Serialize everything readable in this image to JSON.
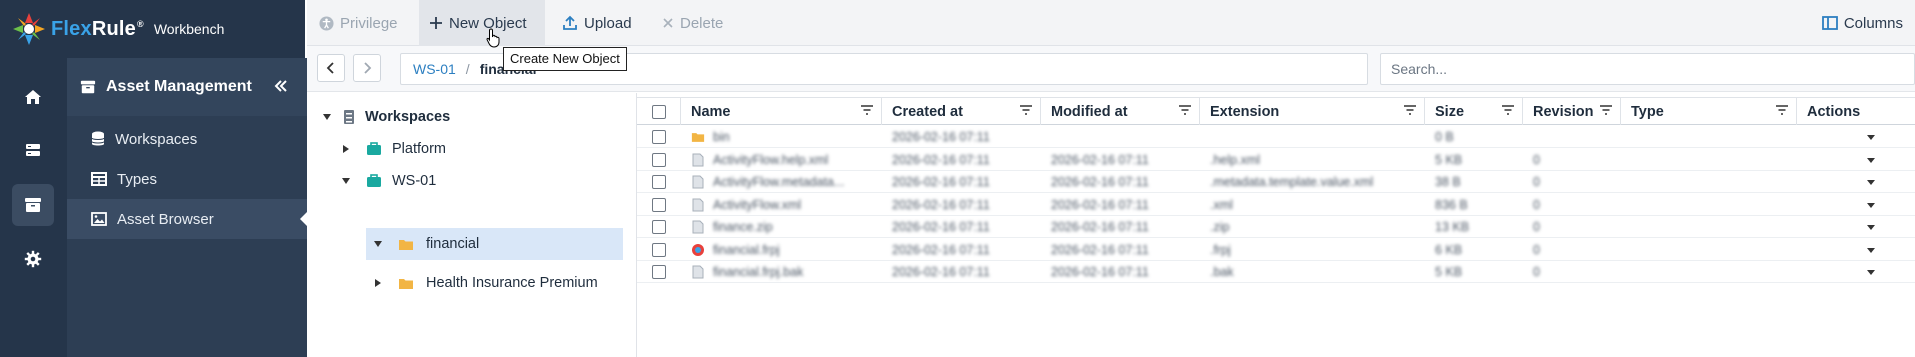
{
  "brand": {
    "name_flex": "Flex",
    "name_rule": "Rule",
    "reg": "®",
    "product": "Workbench"
  },
  "toolbar": {
    "privilege": "Privilege",
    "new_object": "New Object",
    "upload": "Upload",
    "delete": "Delete",
    "columns": "Columns",
    "tooltip": "Create New Object"
  },
  "sidebar": {
    "title": "Asset Management",
    "items": [
      {
        "label": "Workspaces",
        "icon": "database-icon"
      },
      {
        "label": "Types",
        "icon": "table-icon"
      },
      {
        "label": "Asset Browser",
        "icon": "image-icon",
        "active": true
      }
    ]
  },
  "nav": {
    "breadcrumb": [
      "WS-01",
      "financial"
    ],
    "search_placeholder": "Search..."
  },
  "tree": {
    "root": "Workspaces",
    "nodes": [
      {
        "label": "Platform"
      },
      {
        "label": "WS-01"
      },
      {
        "label": "financial"
      },
      {
        "label": "Health Insurance Premium"
      }
    ]
  },
  "grid": {
    "columns": [
      "Name",
      "Created at",
      "Modified at",
      "Extension",
      "Size",
      "Revision",
      "Type",
      "Actions"
    ],
    "rows": [
      {
        "name": "bin",
        "created": "2026-02-16 07:11",
        "modified": "",
        "extension": "",
        "size": "0 B",
        "revision": ""
      },
      {
        "name": "ActivityFlow.help.xml",
        "created": "2026-02-16 07:11",
        "modified": "2026-02-16 07:11",
        "extension": ".help.xml",
        "size": "5 KB",
        "revision": "0"
      },
      {
        "name": "ActivityFlow.metadata...",
        "created": "2026-02-16 07:11",
        "modified": "2026-02-16 07:11",
        "extension": ".metadata.template.value.xml",
        "size": "38 B",
        "revision": "0"
      },
      {
        "name": "ActivityFlow.xml",
        "created": "2026-02-16 07:11",
        "modified": "2026-02-16 07:11",
        "extension": ".xml",
        "size": "836 B",
        "revision": "0"
      },
      {
        "name": "finance.zip",
        "created": "2026-02-16 07:11",
        "modified": "2026-02-16 07:11",
        "extension": ".zip",
        "size": "13 KB",
        "revision": "0"
      },
      {
        "name": "financial.frpj",
        "created": "2026-02-16 07:11",
        "modified": "2026-02-16 07:11",
        "extension": ".frpj",
        "size": "6 KB",
        "revision": "0"
      },
      {
        "name": "financial.frpj.bak",
        "created": "2026-02-16 07:11",
        "modified": "2026-02-16 07:11",
        "extension": ".bak",
        "size": "5 KB",
        "revision": "0"
      }
    ]
  },
  "colors": {
    "rail": "#25354a",
    "panel": "#2d3e54",
    "accent": "#2c7fc1",
    "folder": "#f2b544",
    "teal_case": "#1aa9a0"
  }
}
